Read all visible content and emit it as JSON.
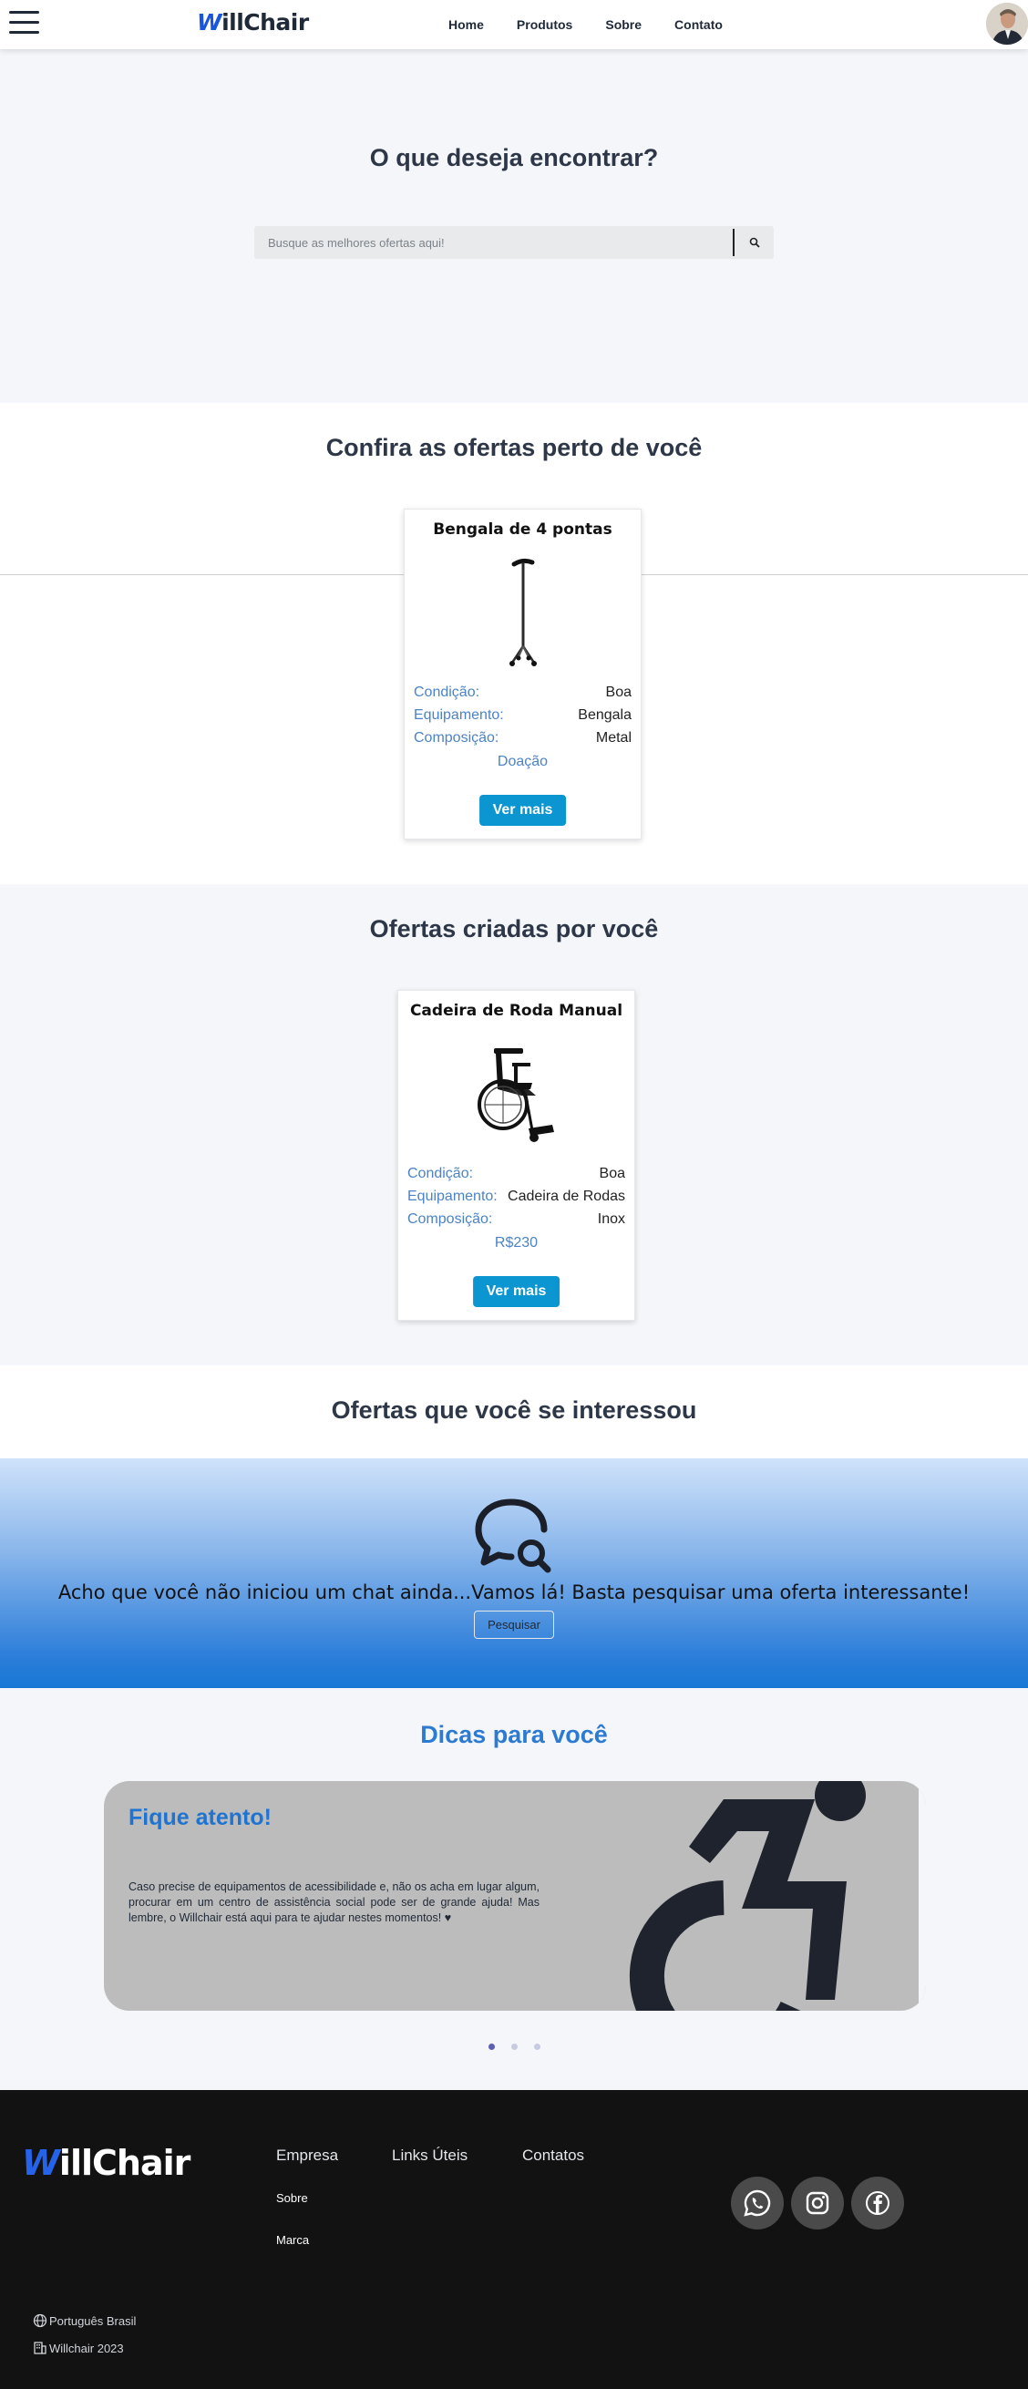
{
  "header": {
    "logo_w": "W",
    "logo_rest": "illChair",
    "nav": [
      "Home",
      "Produtos",
      "Sobre",
      "Contato"
    ]
  },
  "hero": {
    "title": "O que deseja encontrar?",
    "search_placeholder": "Busque as melhores ofertas aqui!"
  },
  "near": {
    "title": "Confira as ofertas perto de você",
    "card": {
      "title": "Bengala de 4 pontas",
      "rows": [
        {
          "k": "Condição:",
          "v": "Boa"
        },
        {
          "k": "Equipamento:",
          "v": "Bengala"
        },
        {
          "k": "Composição:",
          "v": "Metal"
        }
      ],
      "price": "Doação",
      "button": "Ver mais"
    }
  },
  "created": {
    "title": "Ofertas criadas por você",
    "card": {
      "title": "Cadeira de Roda Manual",
      "rows": [
        {
          "k": "Condição:",
          "v": "Boa"
        },
        {
          "k": "Equipamento:",
          "v": "Cadeira de Rodas"
        },
        {
          "k": "Composição:",
          "v": "Inox"
        }
      ],
      "price": "R$230",
      "button": "Ver mais"
    }
  },
  "interest": {
    "title": "Ofertas que você se interessou",
    "message": "Acho que você não iniciou um chat ainda...Vamos lá! Basta pesquisar uma oferta interessante!",
    "button": "Pesquisar"
  },
  "tips": {
    "title": "Dicas para você",
    "slide_title": "Fique atento!",
    "slide_text": "Caso precise de equipamentos de acessibilidade e, não os acha em lugar algum, procurar em um centro de assistência social pode ser de grande ajuda! Mas lembre, o Willchair está aqui para te ajudar nestes momentos! ♥",
    "active_dot": 1,
    "dot_count": 3
  },
  "footer": {
    "logo_w": "W",
    "logo_rest": "illChair",
    "columns": [
      "Empresa",
      "Links Úteis",
      "Contatos"
    ],
    "empresa_links": [
      "Sobre",
      "Marca"
    ],
    "language": "Português Brasil",
    "copyright": "Willchair 2023"
  },
  "colors": {
    "brand_blue": "#1a56db",
    "button_blue": "#0b95d1",
    "label_blue": "#4b83c6",
    "footer_bg": "#121212"
  }
}
